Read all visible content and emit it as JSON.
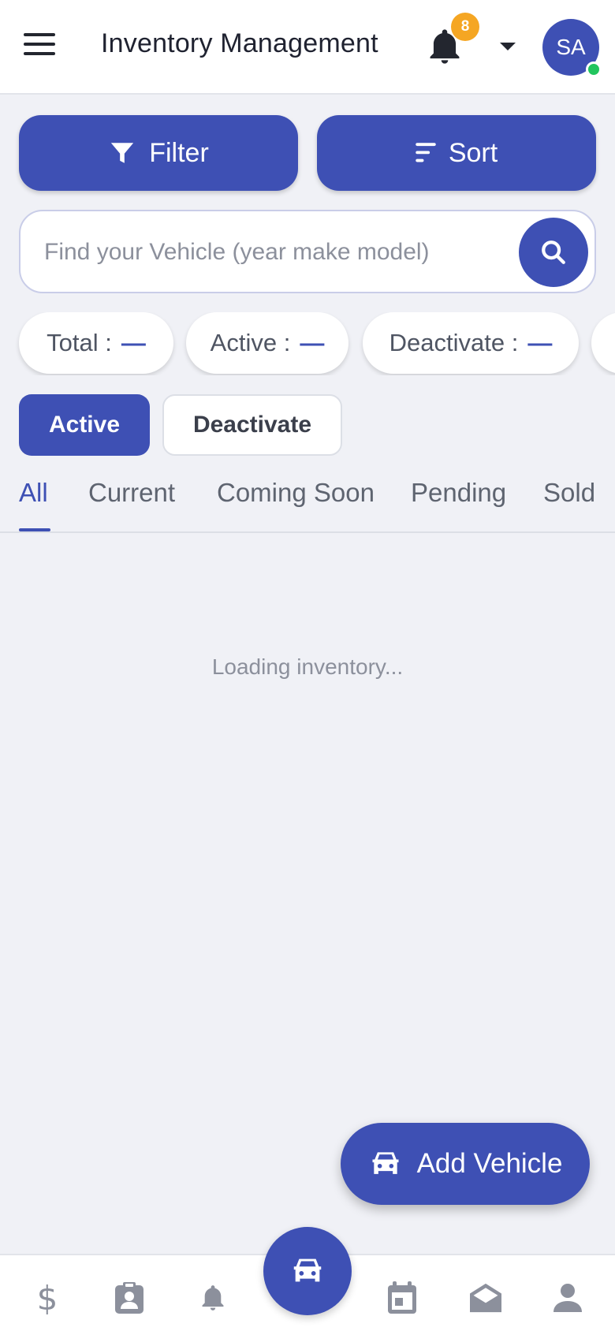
{
  "header": {
    "title": "Inventory Management",
    "notification_count": "8",
    "avatar_initials": "SA",
    "icons": [
      "menu-icon",
      "bell-icon",
      "caret-down-icon"
    ]
  },
  "actions": {
    "filter_label": "Filter",
    "sort_label": "Sort"
  },
  "search": {
    "placeholder": "Find your Vehicle (year make model)",
    "value": ""
  },
  "stats": [
    {
      "label": "Total :",
      "value": "—"
    },
    {
      "label": "Active :",
      "value": "—"
    },
    {
      "label": "Deactivate :",
      "value": "—"
    }
  ],
  "status_toggle": {
    "active_label": "Active",
    "inactive_label": "Deactivate",
    "selected": "Active"
  },
  "tabs": [
    {
      "label": "All",
      "selected": true
    },
    {
      "label": "Current",
      "selected": false
    },
    {
      "label": "Coming Soon",
      "selected": false
    },
    {
      "label": "Pending",
      "selected": false
    },
    {
      "label": "Sold",
      "selected": false
    }
  ],
  "content": {
    "loading_text": "Loading inventory..."
  },
  "fab": {
    "label": "Add Vehicle"
  },
  "bottom_nav": {
    "dollar_glyph": "$",
    "items": [
      "dollar-icon",
      "contact-badge-icon",
      "bell-icon",
      "car-icon",
      "calendar-icon",
      "mail-open-icon",
      "person-icon"
    ],
    "selected": "car-icon"
  },
  "colors": {
    "primary": "#3e50b4",
    "badge": "#f5a623",
    "online": "#22c55e",
    "background": "#f0f1f6"
  }
}
